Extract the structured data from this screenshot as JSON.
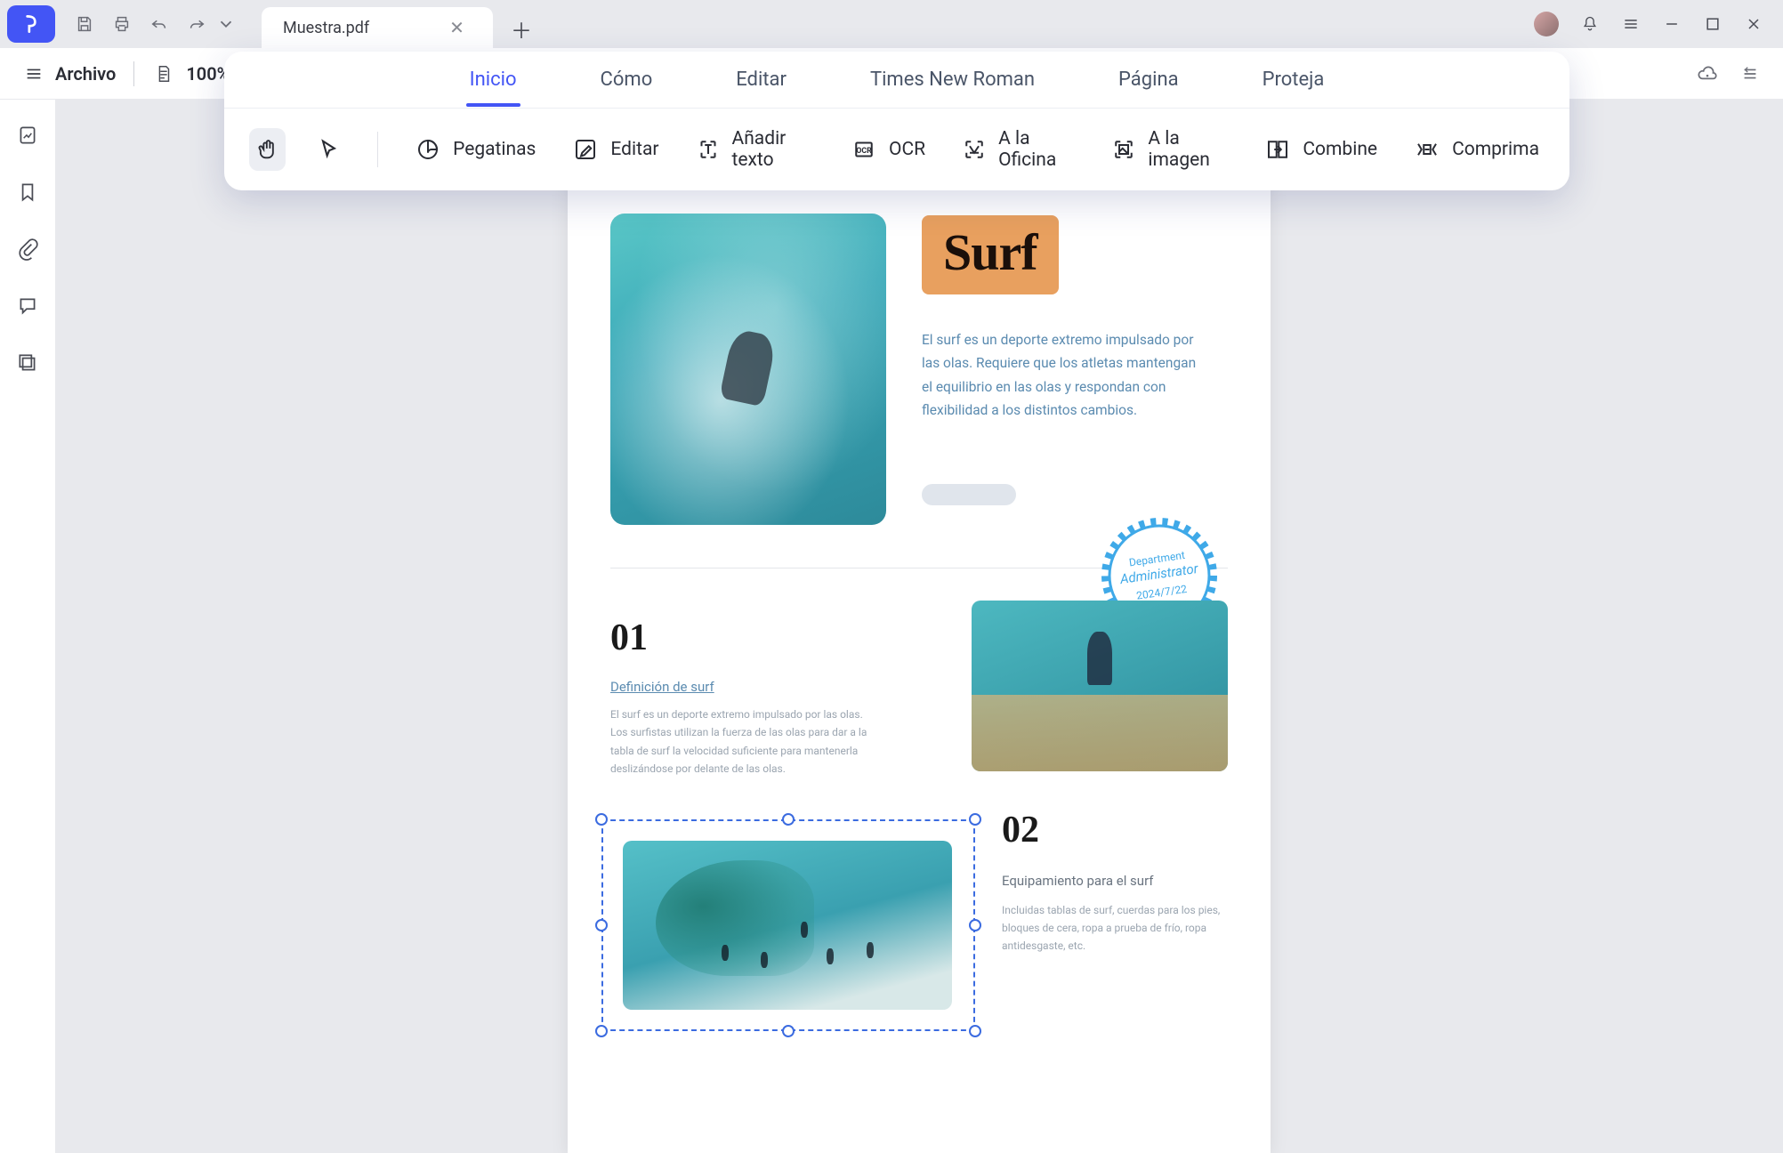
{
  "titlebar": {
    "tab_name": "Muestra.pdf"
  },
  "secondbar": {
    "file_label": "Archivo",
    "zoom": "100%"
  },
  "ribbon": {
    "tabs": [
      "Inicio",
      "Cómo",
      "Editar",
      "Times New Roman",
      "Página",
      "Proteja"
    ],
    "active_tab": 0,
    "tools": {
      "pegatinas": "Pegatinas",
      "editar": "Editar",
      "anadir_texto": "Añadir texto",
      "ocr": "OCR",
      "oficina": "A la Oficina",
      "imagen": "A la imagen",
      "combine": "Combine",
      "comprima": "Comprima"
    }
  },
  "doc": {
    "surf_title": "Surf",
    "hero_desc": "El surf es un deporte extremo impulsado por las olas. Requiere que los atletas mantengan el equilibrio en las olas y respondan con flexibilidad a los distintos cambios.",
    "stamp": {
      "l1": "Department",
      "l2": "Administrator",
      "l3": "2024/7/22"
    },
    "sec01": {
      "num": "01",
      "link": "Definición de surf",
      "body": "El surf es un deporte extremo impulsado por las olas. Los surfistas utilizan la fuerza de las olas para dar a la tabla de surf la velocidad suficiente para mantenerla deslizándose por delante de las olas."
    },
    "sec02": {
      "num": "02",
      "sub": "Equipamiento para el surf",
      "body": "Incluidas tablas de surf, cuerdas para los pies, bloques de cera, ropa a prueba de frío, ropa antidesgaste, etc."
    }
  }
}
